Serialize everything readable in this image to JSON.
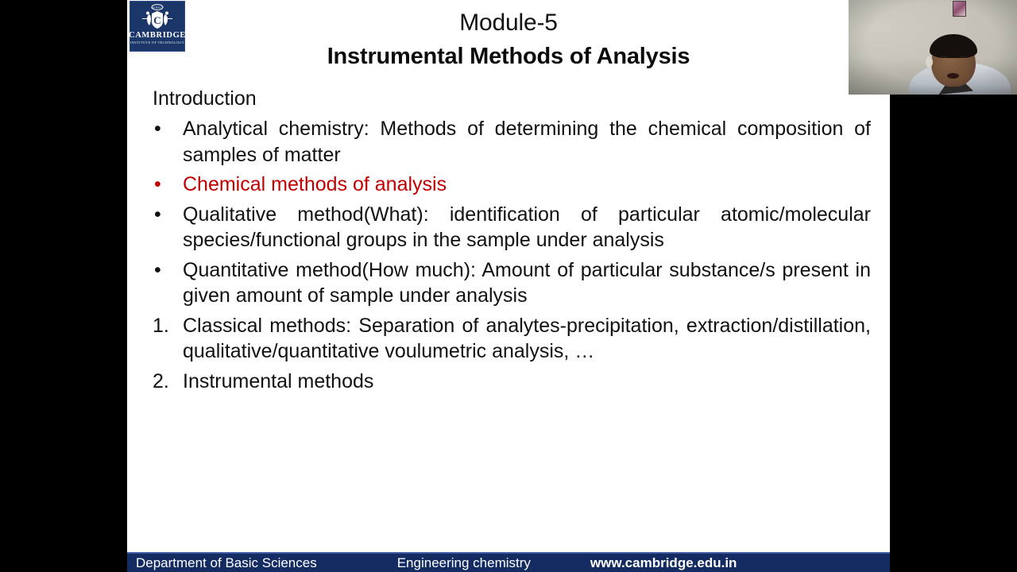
{
  "slide": {
    "logo": {
      "name": "CAMBRIDGE",
      "subtitle": "INSTITUTE OF TECHNOLOGY",
      "icon": "cambridge-crest-icon",
      "bg_color": "#1b3668"
    },
    "title": {
      "line1": "Module-5",
      "line2": "Instrumental Methods of Analysis"
    },
    "lead": "Introduction",
    "bullets": [
      {
        "marker": "•",
        "text": "Analytical chemistry: Methods of determining the chemical composition of samples of matter",
        "color": "#111111",
        "justified": true
      },
      {
        "marker": "•",
        "text": "Chemical methods of analysis",
        "color": "#C00000",
        "justified": false
      },
      {
        "marker": "•",
        "text": "Qualitative method(What): identification of particular atomic/molecular species/functional groups in the sample under analysis",
        "color": "#111111",
        "justified": true
      },
      {
        "marker": "•",
        "text": "Quantitative method(How much): Amount of particular substance/s  present in given amount of sample under analysis",
        "color": "#111111",
        "justified": true
      }
    ],
    "numbered": [
      {
        "marker": "1.",
        "text": "Classical methods: Separation of analytes-precipitation, extraction/distillation, qualitative/quantitative voulumetric analysis, …",
        "justified": true
      },
      {
        "marker": "2. ",
        "text": "Instrumental methods",
        "justified": false
      }
    ],
    "footer": {
      "department": "Department of Basic Sciences",
      "course": "Engineering chemistry",
      "url": "www.cambridge.edu.in",
      "bg_color": "#152c63"
    }
  },
  "webcam": {
    "label": "presenter-video-overlay"
  }
}
